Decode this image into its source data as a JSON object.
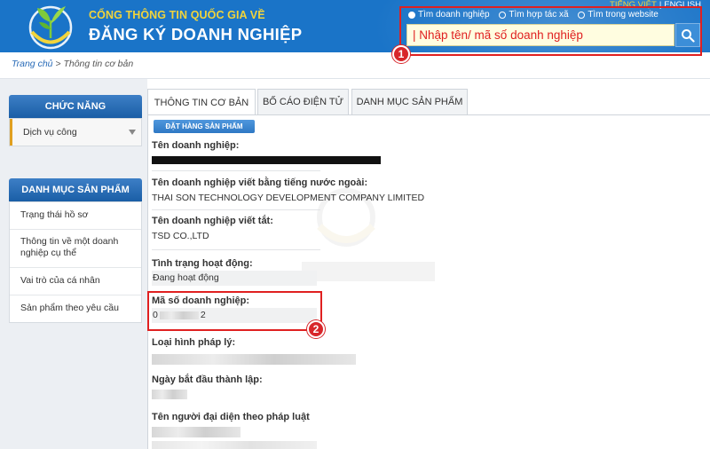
{
  "header": {
    "subtitle": "CỔNG THÔNG TIN QUỐC GIA VỀ",
    "title": "ĐĂNG KÝ DOANH NGHIỆP",
    "lang_vi": "TIẾNG VIỆT",
    "lang_sep": "|",
    "lang_en": "ENGLISH",
    "radios": [
      "Tìm doanh nghiệp",
      "Tìm hợp tác xã",
      "Tìm trong website"
    ],
    "search_placeholder": "| Nhập tên/ mã số doanh nghiệp",
    "badge1": "1",
    "badge2": "2",
    "colors": {
      "header_bg": "#1a74c8",
      "subtitle": "#f2d43b",
      "highlight": "#e02020"
    }
  },
  "breadcrumb": {
    "home": "Trang chủ",
    "current": "Thông tin cơ bản",
    "sep": " > "
  },
  "sidebar": {
    "functions_title": "CHỨC NĂNG",
    "functions_item": "Dịch vụ công",
    "products_title": "DANH MỤC SẢN PHẨM",
    "products_items": [
      "Trạng thái hồ sơ",
      "Thông tin về một doanh nghiệp cụ thể",
      "Vai trò của cá nhân",
      "Sản phẩm theo yêu cầu"
    ]
  },
  "tabs": [
    "THÔNG TIN CƠ BẢN",
    "BỐ CÁO ĐIỆN TỬ",
    "DANH MỤC SẢN PHẨM"
  ],
  "order_button": "ĐẶT HÀNG SẢN PHẨM",
  "fields": {
    "name_label": "Tên doanh nghiệp:",
    "foreign_label": "Tên doanh nghiệp viết bằng tiếng nước ngoài:",
    "foreign_value": "THAI SON TECHNOLOGY DEVELOPMENT COMPANY LIMITED",
    "short_label": "Tên doanh nghiệp viết tắt:",
    "short_value": "TSD CO.,LTD",
    "status_label": "Tình trạng hoạt động:",
    "status_value": "Đang hoạt động",
    "tax_label": "Mã số doanh nghiệp:",
    "tax_value_start": "0",
    "tax_value_end": "2",
    "type_label": "Loại hình pháp lý:",
    "date_label": "Ngày bắt đầu thành lập:",
    "rep_label": "Tên người đại diện theo pháp luật"
  }
}
